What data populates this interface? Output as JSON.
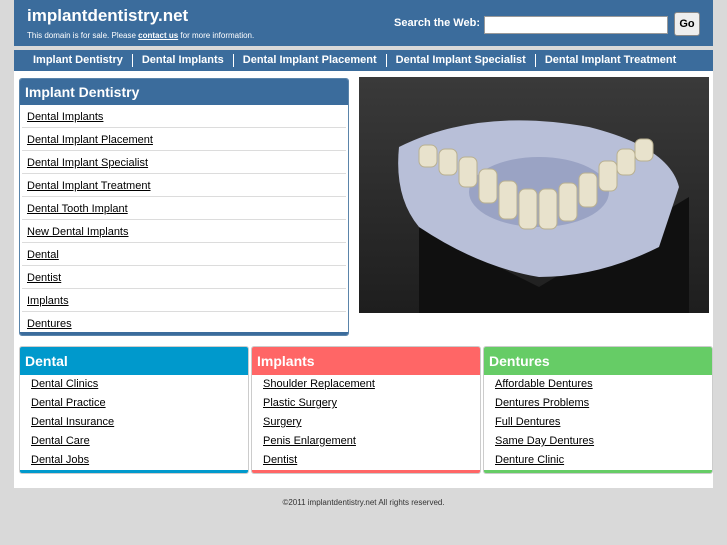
{
  "header": {
    "site_title": "implantdentistry.net",
    "sale_text_pre": "This domain is for sale. Please ",
    "sale_link": "contact us",
    "sale_text_post": " for more information.",
    "search_label": "Search the Web:",
    "search_value": "",
    "go_label": "Go"
  },
  "nav": [
    "Implant Dentistry",
    "Dental Implants",
    "Dental Implant Placement",
    "Dental Implant Specialist",
    "Dental Implant Treatment"
  ],
  "sidebar": {
    "title": "Implant Dentistry",
    "items": [
      "Dental Implants",
      "Dental Implant Placement",
      "Dental Implant Specialist",
      "Dental Implant Treatment",
      "Dental Tooth Implant",
      "New Dental Implants",
      "Dental",
      "Dentist",
      "Implants",
      "Dentures"
    ]
  },
  "categories": [
    {
      "title": "Dental",
      "color": "#0099cc",
      "links": [
        "Dental Clinics",
        "Dental Practice",
        "Dental Insurance",
        "Dental Care",
        "Dental Jobs"
      ]
    },
    {
      "title": "Implants",
      "color": "#ff6666",
      "links": [
        "Shoulder Replacement",
        "Plastic Surgery",
        "Surgery",
        "Penis Enlargement",
        "Dentist"
      ]
    },
    {
      "title": "Dentures",
      "color": "#66cc66",
      "links": [
        "Affordable Dentures",
        "Dentures Problems",
        "Full Dentures",
        "Same Day Dentures",
        "Denture Clinic"
      ]
    }
  ],
  "colors": {
    "header_bg": "#3b6c9c",
    "page_bg": "#d9d9d9"
  },
  "hero_image": "dental-implant-model",
  "footer": "©2011 implantdentistry.net All rights reserved."
}
